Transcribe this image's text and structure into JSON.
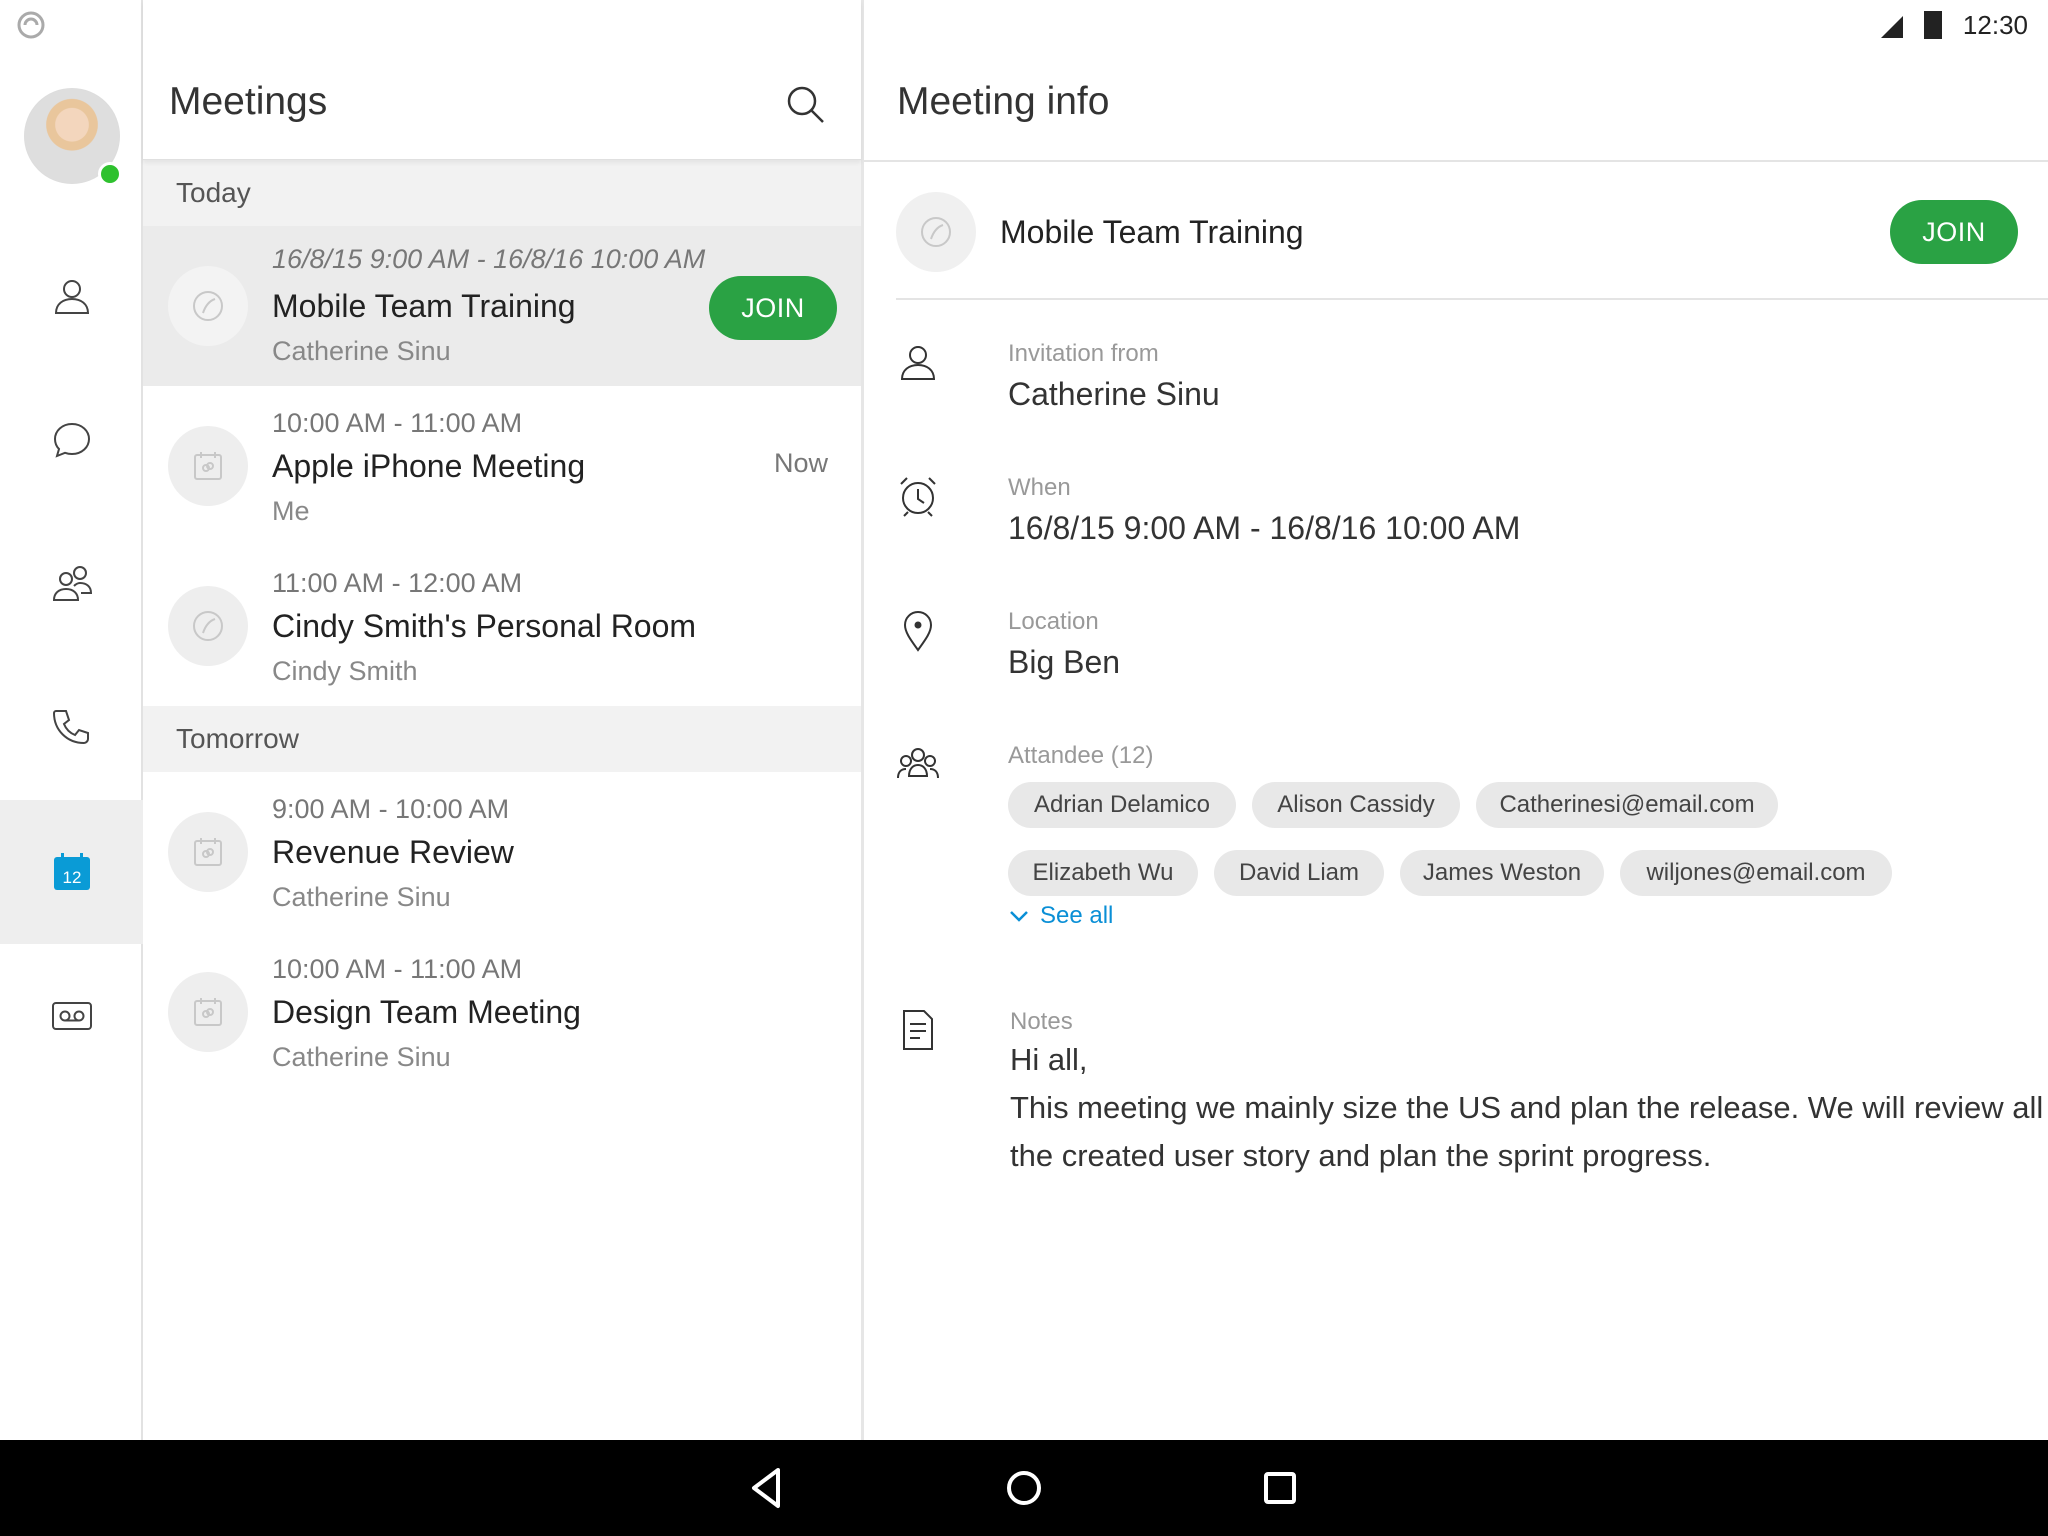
{
  "status": {
    "time": "12:30"
  },
  "rail": {
    "items": [
      {
        "icon": "contacts-icon"
      },
      {
        "icon": "chat-icon"
      },
      {
        "icon": "groups-icon"
      },
      {
        "icon": "phone-icon"
      },
      {
        "icon": "calendar-icon",
        "badge": "12",
        "active": true
      },
      {
        "icon": "voicemail-icon"
      }
    ]
  },
  "meetings_panel": {
    "title": "Meetings",
    "sections": [
      {
        "label": "Today",
        "items": [
          {
            "time": "16/8/15 9:00 AM - 16/8/16 10:00 AM",
            "name": "Mobile Team Training",
            "host": "Catherine Sinu",
            "action": "JOIN",
            "icon": "webex-icon",
            "selected": true
          },
          {
            "time": "10:00 AM - 11:00 AM",
            "name": "Apple iPhone Meeting",
            "host": "Me",
            "badge": "Now",
            "icon": "meeting-calendar-icon"
          },
          {
            "time": "11:00 AM - 12:00 AM",
            "name": "Cindy Smith's Personal Room",
            "host": "Cindy Smith",
            "icon": "webex-icon"
          }
        ]
      },
      {
        "label": "Tomorrow",
        "items": [
          {
            "time": "9:00 AM - 10:00 AM",
            "name": "Revenue Review",
            "host": "Catherine Sinu",
            "icon": "meeting-calendar-icon"
          },
          {
            "time": "10:00 AM - 11:00 AM",
            "name": "Design  Team  Meeting",
            "host": "Catherine Sinu",
            "icon": "meeting-calendar-icon"
          }
        ]
      }
    ]
  },
  "detail": {
    "title": "Meeting info",
    "meeting_name": "Mobile Team Training",
    "join_label": "JOIN",
    "invitation": {
      "label": "Invitation from",
      "value": "Catherine Sinu"
    },
    "when": {
      "label": "When",
      "value": "16/8/15 9:00 AM - 16/8/16 10:00 AM"
    },
    "location": {
      "label": "Location",
      "value": "Big Ben"
    },
    "attendees": {
      "label": "Attandee (12)",
      "chips": [
        "Adrian Delamico",
        "Alison Cassidy",
        "Catherinesi@email.com",
        "Elizabeth Wu",
        "David Liam",
        "James Weston",
        "wiljones@email.com"
      ],
      "see_all": "See all"
    },
    "notes": {
      "label": "Notes",
      "line1": "Hi all,",
      "line2": "This meeting we mainly size the US and plan the release. We will review all the created user story and plan the sprint progress."
    }
  },
  "colors": {
    "join": "#2aa244",
    "link": "#0a8fd6",
    "calendar_active": "#0a9bd6",
    "presence": "#2ec12e"
  }
}
